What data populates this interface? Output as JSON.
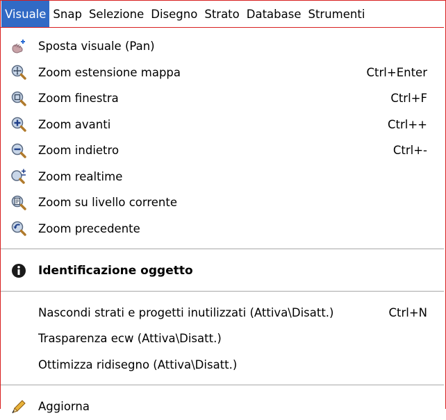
{
  "menubar": {
    "items": [
      {
        "label": "Visuale",
        "active": true
      },
      {
        "label": "Snap"
      },
      {
        "label": "Selezione"
      },
      {
        "label": "Disegno"
      },
      {
        "label": "Strato"
      },
      {
        "label": "Database"
      },
      {
        "label": "Strumenti"
      }
    ]
  },
  "menu": {
    "group1": [
      {
        "label": "Sposta visuale (Pan)",
        "shortcut": "",
        "icon": "pan-hand-icon"
      },
      {
        "label": "Zoom estensione mappa",
        "shortcut": "Ctrl+Enter",
        "icon": "zoom-extent-icon"
      },
      {
        "label": "Zoom finestra",
        "shortcut": "Ctrl+F",
        "icon": "zoom-window-icon"
      },
      {
        "label": "Zoom avanti",
        "shortcut": "Ctrl++",
        "icon": "zoom-in-icon"
      },
      {
        "label": "Zoom indietro",
        "shortcut": "Ctrl+-",
        "icon": "zoom-out-icon"
      },
      {
        "label": "Zoom realtime",
        "shortcut": "",
        "icon": "zoom-realtime-icon"
      },
      {
        "label": "Zoom su livello corrente",
        "shortcut": "",
        "icon": "zoom-layer-icon"
      },
      {
        "label": "Zoom precedente",
        "shortcut": "",
        "icon": "zoom-previous-icon"
      }
    ],
    "identify": {
      "label": "Identificazione oggetto",
      "icon": "info-icon"
    },
    "toggles": [
      {
        "label": "Nascondi strati e progetti inutilizzati (Attiva\\Disatt.)",
        "shortcut": "Ctrl+N"
      },
      {
        "label": "Trasparenza ecw (Attiva\\Disatt.)",
        "shortcut": ""
      },
      {
        "label": "Ottimizza ridisegno (Attiva\\Disatt.)",
        "shortcut": ""
      }
    ],
    "refresh": {
      "label": "Aggiorna",
      "icon": "pencil-icon"
    }
  },
  "colors": {
    "highlight": "#316ac5",
    "border": "#d81e1e",
    "separator": "#a8a8a8"
  }
}
